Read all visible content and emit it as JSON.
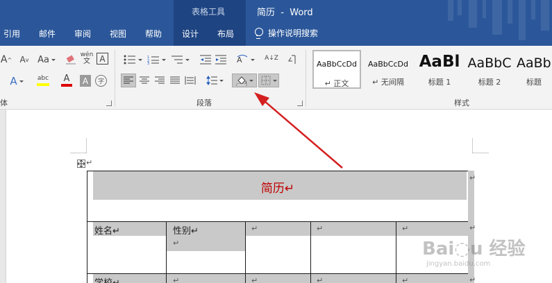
{
  "titlebar": {
    "context_group": "表格工具",
    "document_title": "简历  -  Word"
  },
  "tabs": [
    "引用",
    "邮件",
    "审阅",
    "视图",
    "帮助",
    "设计",
    "布局"
  ],
  "tell_me": "操作说明搜索",
  "ribbon": {
    "font_group_label": "体",
    "paragraph_group_label": "段落",
    "styles_group_label": "样式",
    "font_controls": {
      "grow": "A",
      "shrink": "A",
      "case": "Aa",
      "phonetic": "wén",
      "border_char": "A",
      "effects": "A",
      "highlight": "abc",
      "font_color": "A",
      "shade_char": "A",
      "enclose": "字"
    },
    "sort_glyph": "A↓Z",
    "styles": [
      {
        "sample": "AaBbCcDd",
        "name": "↵ 正文"
      },
      {
        "sample": "AaBbCcDd",
        "name": "↵ 无间隔"
      },
      {
        "sample": "AaBl",
        "name": "标题 1"
      },
      {
        "sample": "AaBbC",
        "name": "标题 2"
      },
      {
        "sample": "AaBb",
        "name": "标题"
      }
    ]
  },
  "document": {
    "table_title": "简历↵",
    "row2": [
      "姓名↵",
      "性别↵",
      "↵",
      "↵",
      "↵"
    ],
    "row2_sub": "↵",
    "row3": [
      "学校↵",
      "↵",
      "↵",
      "↵",
      "↵"
    ],
    "end_marks": "↵",
    "move_handle_mark": "↵"
  },
  "colors": {
    "titlebar": "#2b579a",
    "context_tab": "#1e4482",
    "title_text": "#c00000",
    "cell_shade": "#c9c9c9",
    "arrow": "#d42020"
  },
  "watermark": {
    "brand": "Bai◌u 经验",
    "url": "jingyan.baidu.com"
  }
}
